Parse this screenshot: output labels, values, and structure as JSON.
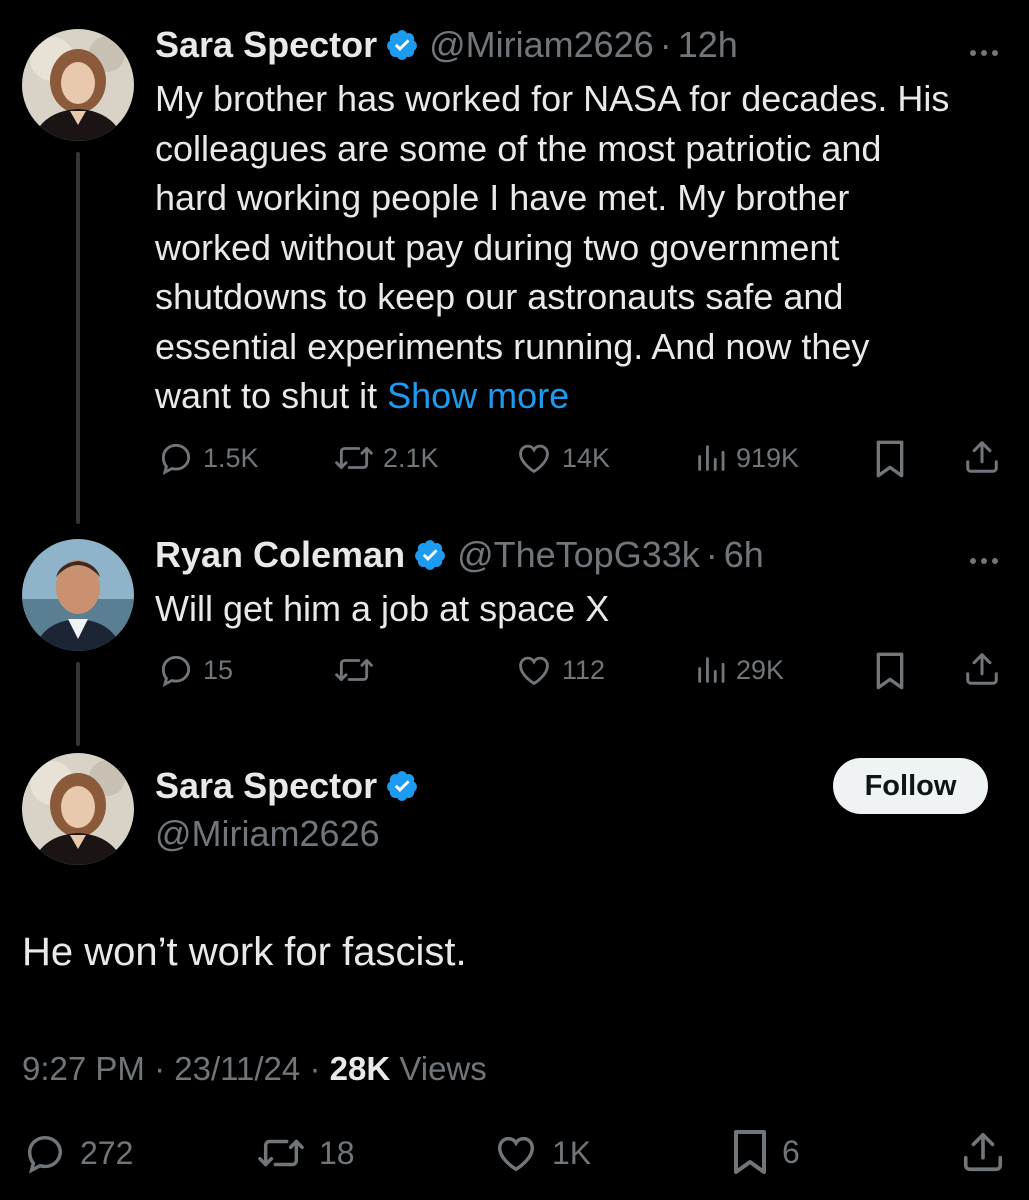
{
  "tweet1": {
    "name": "Sara Spector",
    "handle": "@Miriam2626",
    "time": "12h",
    "text_lines": [
      "My brother has worked for NASA for decades. His",
      "colleagues are some of the most patriotic and",
      "hard working people I have met. My brother",
      "worked without pay during two government",
      "shutdowns to keep our astronauts safe and",
      "essential experiments running. And now they",
      "want to shut it "
    ],
    "show_more": "Show more",
    "replies": "1.5K",
    "reposts": "2.1K",
    "likes": "14K",
    "views": "919K"
  },
  "tweet2": {
    "name": "Ryan Coleman",
    "handle": "@TheTopG33k",
    "time": "6h",
    "text": "Will get him a job at space X",
    "replies": "15",
    "reposts": "",
    "likes": "112",
    "views": "29K"
  },
  "main": {
    "name": "Sara Spector",
    "handle": "@Miriam2626",
    "follow_label": "Follow",
    "text": "He won’t work for fascist.",
    "time": "9:27 PM",
    "date": "23/11/24",
    "views_count": "28K",
    "views_label": "Views",
    "replies": "272",
    "reposts": "18",
    "likes": "1K",
    "bookmarks": "6"
  },
  "colors": {
    "background": "#000000",
    "text": "#e7e9ea",
    "muted": "#71767b",
    "link": "#1d9bf0",
    "verified": "#1d9bf0"
  },
  "icons": [
    "reply-icon",
    "repost-icon",
    "like-icon",
    "views-icon",
    "bookmark-icon",
    "share-icon",
    "verified-badge-icon",
    "more-icon"
  ]
}
